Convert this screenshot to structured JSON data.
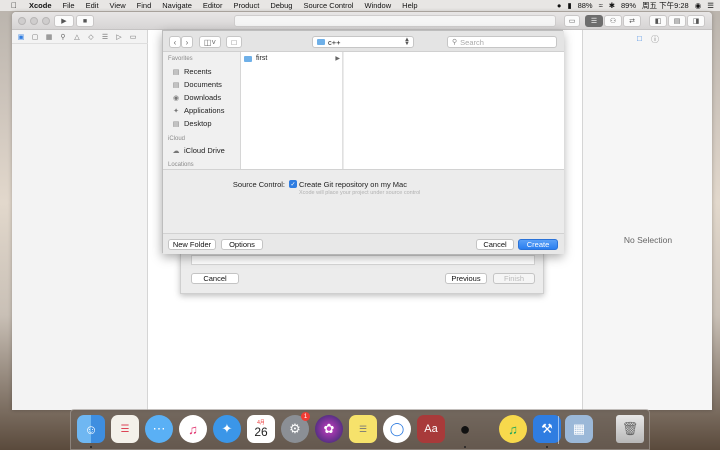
{
  "menubar": {
    "apple": "",
    "app_name": "Xcode",
    "menus": [
      "File",
      "Edit",
      "View",
      "Find",
      "Navigate",
      "Editor",
      "Product",
      "Debug",
      "Source Control",
      "Window",
      "Help"
    ],
    "battery_left": "88%",
    "wifi_battery": "89%",
    "clock": "周五 下午9:28"
  },
  "inspector": {
    "no_selection": "No Selection"
  },
  "save_panel": {
    "location": "c++",
    "search_placeholder": "Search",
    "sidebar": {
      "favorites_header": "Favorites",
      "favorites": [
        {
          "label": "Recents",
          "icon": "clock-icon"
        },
        {
          "label": "Documents",
          "icon": "documents-icon"
        },
        {
          "label": "Downloads",
          "icon": "downloads-icon"
        },
        {
          "label": "Applications",
          "icon": "applications-icon"
        },
        {
          "label": "Desktop",
          "icon": "desktop-icon"
        }
      ],
      "icloud_header": "iCloud",
      "icloud": [
        {
          "label": "iCloud Drive",
          "icon": "cloud-icon"
        }
      ],
      "locations_header": "Locations"
    },
    "columns": {
      "col1_items": [
        "first"
      ]
    },
    "source_control_label": "Source Control:",
    "git_checkbox_label": "Create Git repository on my Mac",
    "git_checked": true,
    "git_hint": "Xcode will place your project under source control",
    "buttons": {
      "new_folder": "New Folder",
      "options": "Options",
      "cancel": "Cancel",
      "create": "Create"
    }
  },
  "template_sheet": {
    "cancel": "Cancel",
    "previous": "Previous",
    "finish": "Finish"
  },
  "dock": {
    "apps": [
      "finder-icon",
      "reminders-icon",
      "messages-icon",
      "itunes-icon",
      "safari-icon",
      "calendar-icon",
      "system-preferences-icon",
      "siri-icon",
      "stickies-icon",
      "quicktime-icon",
      "dictionary-icon",
      "qq-icon",
      "music-app-icon",
      "xcode-icon",
      "preview-icon",
      "trash-icon"
    ],
    "calendar_month": "4月",
    "calendar_day": "26",
    "sysprefs_badge": "1"
  },
  "colors": {
    "accent": "#2f7de1",
    "folder": "#6fb0e8"
  }
}
